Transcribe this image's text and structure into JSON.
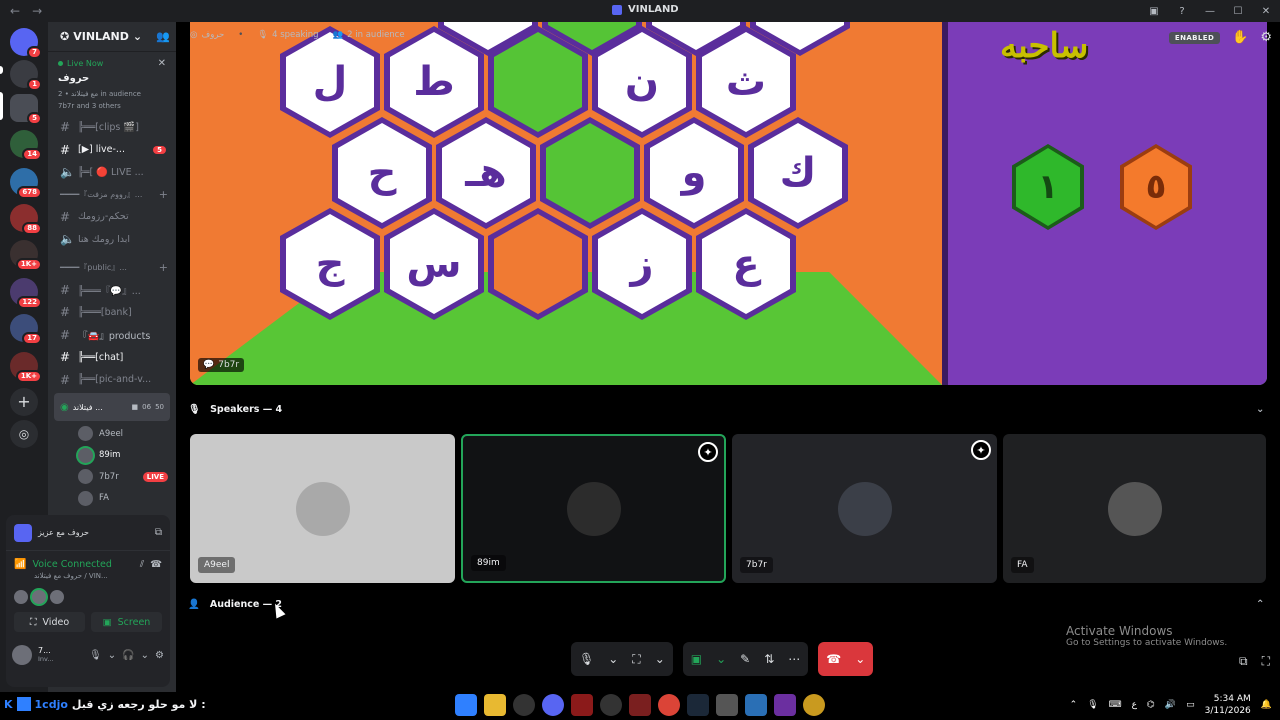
{
  "window": {
    "title": "VINLAND",
    "back": "←",
    "forward": "→"
  },
  "server_rail": {
    "badges": [
      "7",
      "1",
      "5",
      "14",
      "678",
      "88",
      "1K+",
      "122",
      "17",
      "1K+"
    ]
  },
  "server": {
    "name": "VINLAND"
  },
  "live": {
    "status": "Live Now",
    "title": "حروف",
    "sub1": "مع فيتلاند • 2 in audience",
    "sub2": "7b7r and 3 others"
  },
  "channels": [
    {
      "name": "╠══[clips 🎬]",
      "bright": false
    },
    {
      "name": "[▶] live-...",
      "bright": true,
      "count": "5"
    },
    {
      "name": "╠═[ 🔴 LIVE ...",
      "bright": false,
      "voice": true
    }
  ],
  "category1": "━━━━『رووم مزفت』...",
  "chans2": [
    {
      "name": "تحكم-رزومك",
      "bright": false
    },
    {
      "name": "ابدا رومك هنا",
      "bright": false
    }
  ],
  "category2": "━━━━『public』...",
  "chans3": [
    {
      "name": "╠═══『💬』...",
      "bright": false
    },
    {
      "name": "╠═══[bank]",
      "bright": false
    },
    {
      "name": "『🚘』products",
      "bright": false
    },
    {
      "name": "╠══[chat]",
      "bright": true
    },
    {
      "name": "╠══[pic-and-v...",
      "bright": false
    }
  ],
  "voice_channel": {
    "name": "فيتلاند ...",
    "sub": "حروف",
    "tag1": "06",
    "tag2": "50"
  },
  "voice_users": [
    {
      "name": "A9eel",
      "speaking": false,
      "bright": false
    },
    {
      "name": "89im",
      "speaking": true,
      "bright": true
    },
    {
      "name": "7b7r",
      "speaking": false,
      "bright": false,
      "live": "LIVE"
    },
    {
      "name": "FA",
      "speaking": false,
      "bright": false
    }
  ],
  "activity": {
    "title": "حروف مع عزيز"
  },
  "voice_status": {
    "label": "Voice Connected",
    "sub": "حروف مع فيتلاند / VIN..."
  },
  "panel_buttons": {
    "video": "Video",
    "screen": "Screen"
  },
  "me": {
    "name": "7...",
    "status": "Inv..."
  },
  "stage": {
    "channel": "حروف",
    "speaking": "4 speaking",
    "audience": "2 in audience",
    "enabled": "ENABLED",
    "stream_tag": "7b7r",
    "speakers_header": "Speakers — 4",
    "audience_header": "Audience — 2"
  },
  "board": {
    "row1": [
      "ل",
      "ط",
      "",
      "ن",
      "ث"
    ],
    "row2": [
      "ح",
      "هـ",
      "",
      "و",
      "ك"
    ],
    "row3": [
      "ج",
      "س",
      "",
      "ز",
      "ع"
    ],
    "score_green": "١",
    "score_orange": "٥",
    "logo": "ساحبه"
  },
  "speakers": [
    {
      "name": "A9eel",
      "star": false,
      "active": false
    },
    {
      "name": "89im",
      "star": true,
      "active": true
    },
    {
      "name": "7b7r",
      "star": true,
      "active": false
    },
    {
      "name": "FA",
      "star": false,
      "active": false
    }
  ],
  "watermark": {
    "title": "Activate Windows",
    "sub": "Go to Settings to activate Windows."
  },
  "taskbar": {
    "left_label": "1cdjo",
    "left_text": "لا مو حلو رجعه زي قبل :",
    "lang": "ع",
    "time": "5:34 AM",
    "date": "3/11/2026"
  },
  "colors": {
    "accent_green": "#23a559",
    "danger": "#da373c",
    "board_purple": "#5a2d9c",
    "board_orange": "#f07a33"
  }
}
